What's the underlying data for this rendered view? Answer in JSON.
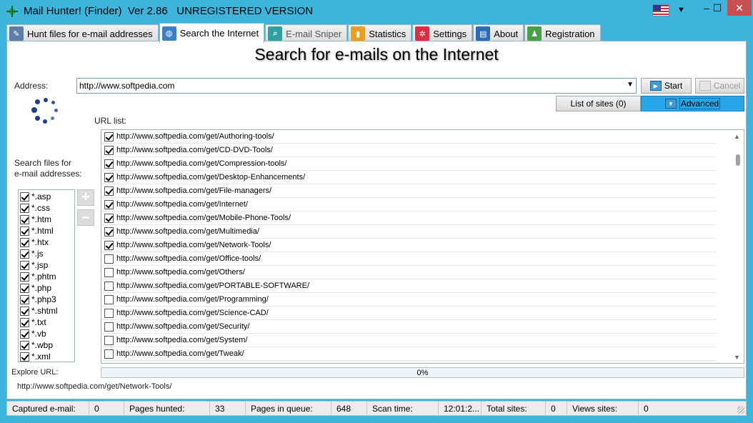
{
  "window": {
    "title": "Mail Hunter! (Finder)  Ver 2.86   UNREGISTERED VERSION",
    "controls": {
      "minimize": "–",
      "maximize": "☐",
      "close": "✕"
    }
  },
  "tabs": [
    {
      "label": "Hunt files for e-mail addresses",
      "icon": "file-search-icon",
      "color": "#5b7fa6"
    },
    {
      "label": "Search the Internet",
      "icon": "globe-icon",
      "color": "#3a7dc8",
      "active": true
    },
    {
      "label": "E-mail Sniper",
      "icon": "sniper-icon",
      "color": "#30a0a0"
    },
    {
      "label": "Statistics",
      "icon": "statistics-icon",
      "color": "#e8a020"
    },
    {
      "label": "Settings",
      "icon": "gear-icon",
      "color": "#d83040"
    },
    {
      "label": "About",
      "icon": "book-icon",
      "color": "#2a6cb8"
    },
    {
      "label": "Registration",
      "icon": "user-icon",
      "color": "#48a048"
    }
  ],
  "main": {
    "heading": "Search for e-mails on the Internet",
    "address_label": "Address:",
    "address_value": "http://www.softpedia.com",
    "start_label": "Start",
    "cancel_label": "Cancel",
    "list_sites_label": "List of sites (0)",
    "advanced_label": "Advanced",
    "url_list_label": "URL list:",
    "search_files_label_1": "Search files for",
    "search_files_label_2": "e-mail addresses:",
    "add_button": "+",
    "remove_button": "–",
    "extensions": [
      {
        "name": "*.asp",
        "checked": true
      },
      {
        "name": "*.css",
        "checked": true
      },
      {
        "name": "*.htm",
        "checked": true
      },
      {
        "name": "*.html",
        "checked": true
      },
      {
        "name": "*.htx",
        "checked": true
      },
      {
        "name": "*.js",
        "checked": true
      },
      {
        "name": "*.jsp",
        "checked": true
      },
      {
        "name": "*.phtm",
        "checked": true
      },
      {
        "name": "*.php",
        "checked": true
      },
      {
        "name": "*.php3",
        "checked": true
      },
      {
        "name": "*.shtml",
        "checked": true
      },
      {
        "name": "*.txt",
        "checked": true
      },
      {
        "name": "*.vb",
        "checked": true
      },
      {
        "name": "*.wbp",
        "checked": true
      },
      {
        "name": "*.xml",
        "checked": true
      }
    ],
    "urls": [
      {
        "url": "http://www.softpedia.com/get/Authoring-tools/",
        "checked": true
      },
      {
        "url": "http://www.softpedia.com/get/CD-DVD-Tools/",
        "checked": true
      },
      {
        "url": "http://www.softpedia.com/get/Compression-tools/",
        "checked": true
      },
      {
        "url": "http://www.softpedia.com/get/Desktop-Enhancements/",
        "checked": true
      },
      {
        "url": "http://www.softpedia.com/get/File-managers/",
        "checked": true
      },
      {
        "url": "http://www.softpedia.com/get/Internet/",
        "checked": true
      },
      {
        "url": "http://www.softpedia.com/get/Mobile-Phone-Tools/",
        "checked": true
      },
      {
        "url": "http://www.softpedia.com/get/Multimedia/",
        "checked": true
      },
      {
        "url": "http://www.softpedia.com/get/Network-Tools/",
        "checked": true
      },
      {
        "url": "http://www.softpedia.com/get/Office-tools/",
        "checked": false
      },
      {
        "url": "http://www.softpedia.com/get/Others/",
        "checked": false
      },
      {
        "url": "http://www.softpedia.com/get/PORTABLE-SOFTWARE/",
        "checked": false
      },
      {
        "url": "http://www.softpedia.com/get/Programming/",
        "checked": false
      },
      {
        "url": "http://www.softpedia.com/get/Science-CAD/",
        "checked": false
      },
      {
        "url": "http://www.softpedia.com/get/Security/",
        "checked": false
      },
      {
        "url": "http://www.softpedia.com/get/System/",
        "checked": false
      },
      {
        "url": "http://www.softpedia.com/get/Tweak/",
        "checked": false
      }
    ],
    "explore_label": "Explore URL:",
    "progress_text": "0%",
    "current_url": "http://www.softpedia.com/get/Network-Tools/"
  },
  "status": {
    "captured_label": "Captured e-mail:",
    "captured_value": "0",
    "pages_hunted_label": "Pages hunted:",
    "pages_hunted_value": "33",
    "queue_label": "Pages in queue:",
    "queue_value": "648",
    "scan_time_label": "Scan time:",
    "scan_time_value": "12:01:2...",
    "total_sites_label": "Total sites:",
    "total_sites_value": "0",
    "views_sites_label": "Views sites:",
    "views_sites_value": "0"
  },
  "colors": {
    "titlebar": "#3cb4dc",
    "accent": "#27a7e7",
    "close": "#c75050"
  }
}
